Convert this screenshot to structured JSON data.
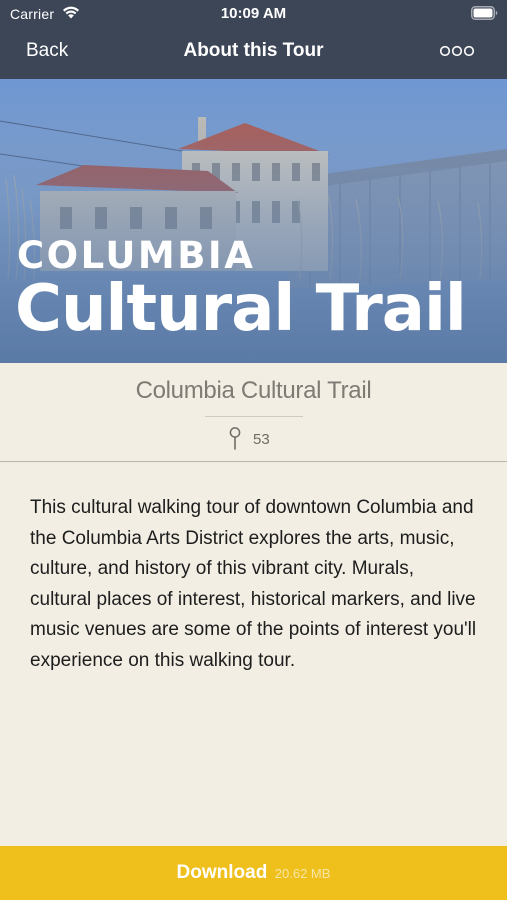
{
  "status_bar": {
    "carrier": "Carrier",
    "time": "10:09 AM"
  },
  "nav": {
    "back_label": "Back",
    "title": "About this Tour",
    "more_icon": "ellipsis-icon"
  },
  "hero": {
    "line1": "COLUMBIA",
    "line2": "Cultural Trail"
  },
  "tour": {
    "name": "Columbia Cultural Trail",
    "stop_count": "53",
    "stop_icon": "map-pin-icon",
    "description": "This cultural walking tour of downtown Columbia and the Columbia Arts District explores the arts, music, culture, and history of this vibrant city. Murals, cultural places of interest, historical markers, and live music venues are some of the points of interest you'll experience on this walking tour."
  },
  "download": {
    "label": "Download",
    "size": "20.62 MB"
  },
  "colors": {
    "nav_bar": "#3d4657",
    "background": "#f2eee4",
    "download_button": "#efbf1c",
    "hero_overlay": "#6f8fb8"
  }
}
